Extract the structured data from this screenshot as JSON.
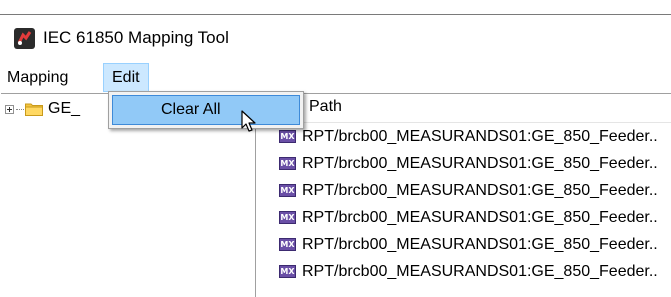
{
  "window": {
    "title": "IEC 61850 Mapping Tool",
    "icon": "app-logo-icon"
  },
  "menubar": {
    "items": [
      "Mapping",
      "Edit"
    ],
    "active": "Edit"
  },
  "edit_menu": {
    "items": [
      "Clear All"
    ]
  },
  "tree": {
    "items": [
      {
        "label": "GE_",
        "icon": "folder-icon",
        "expanded": false
      }
    ]
  },
  "list": {
    "header": "Path",
    "item_icon": "mx-icon",
    "item_icon_text": "MX",
    "rows": [
      "RPT/brcb00_MEASURANDS01:GE_850_Feeder..",
      "RPT/brcb00_MEASURANDS01:GE_850_Feeder..",
      "RPT/brcb00_MEASURANDS01:GE_850_Feeder..",
      "RPT/brcb00_MEASURANDS01:GE_850_Feeder..",
      "RPT/brcb00_MEASURANDS01:GE_850_Feeder..",
      "RPT/brcb00_MEASURANDS01:GE_850_Feeder.."
    ]
  },
  "colors": {
    "menu_highlight": "#cce8ff",
    "dropdown_hover": "#91c9f7",
    "mx_icon": "#6a4fa6"
  }
}
